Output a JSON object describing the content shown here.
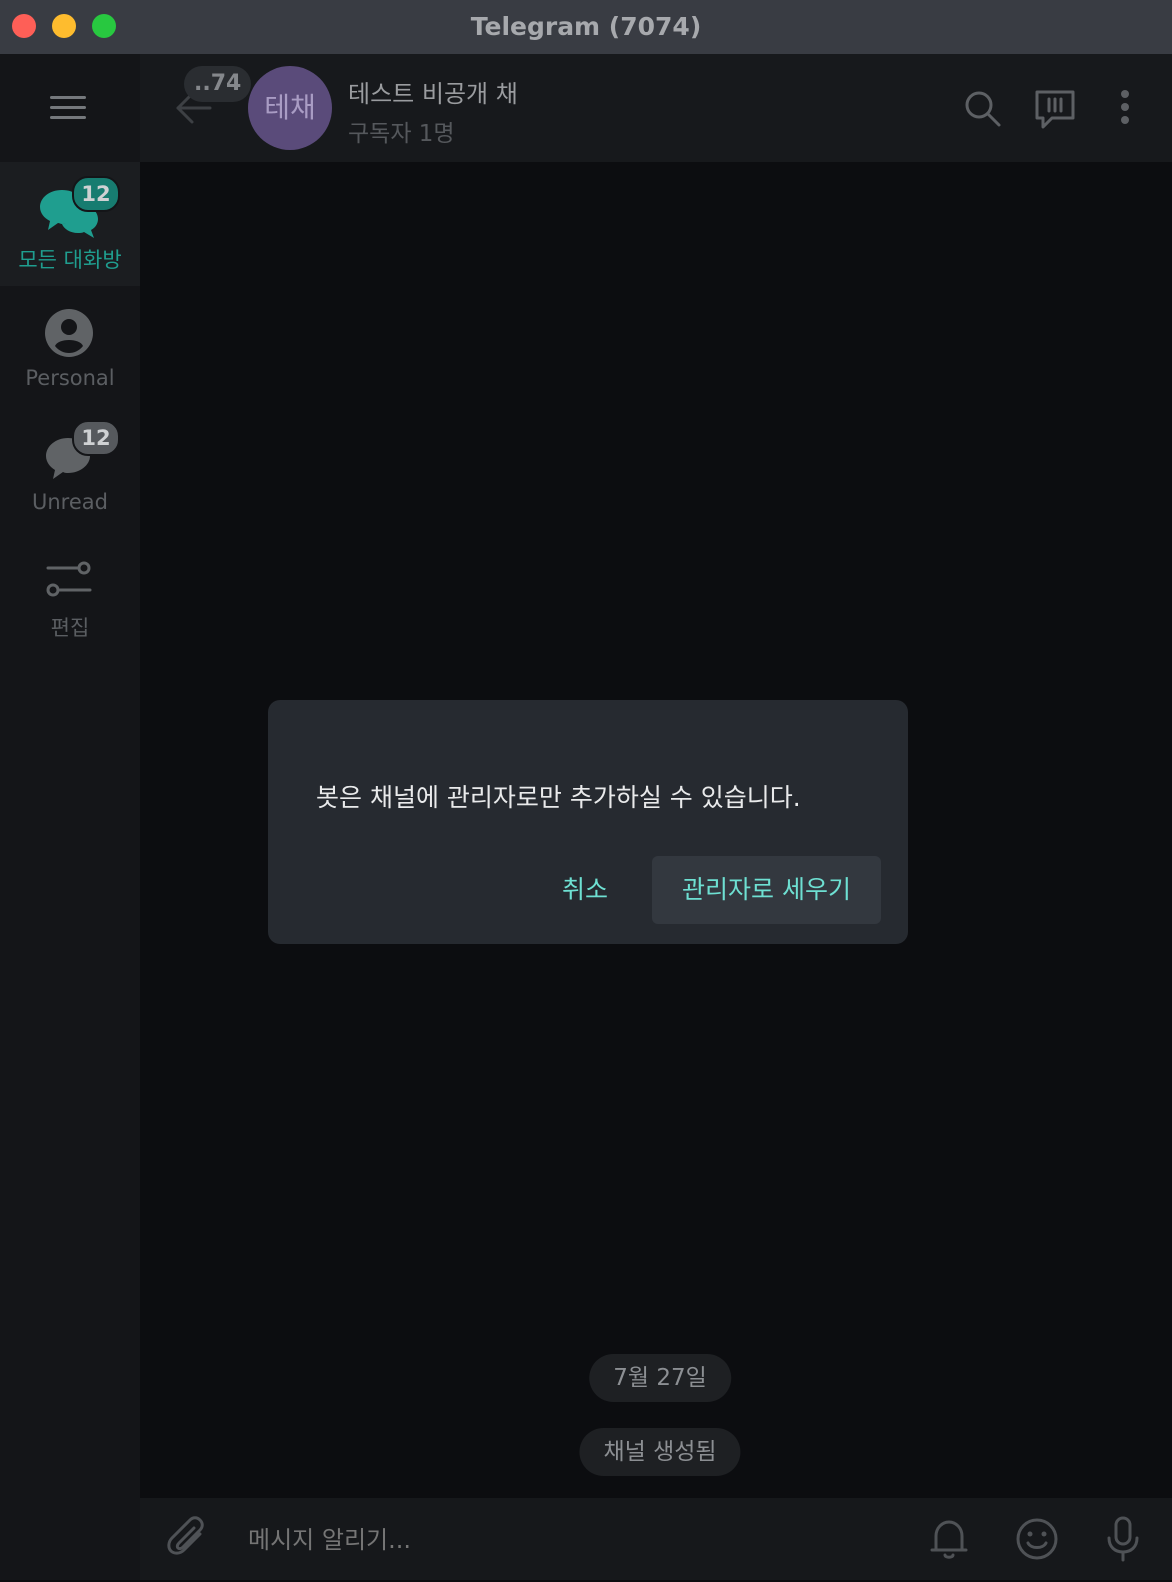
{
  "window": {
    "title": "Telegram (7074)",
    "traffic_lights": [
      "#fe5f57",
      "#febc2e",
      "#28c840"
    ]
  },
  "sidebar": {
    "menu_icon": "hamburger-icon",
    "folders": [
      {
        "label": "모든 대화방",
        "icon": "chats-icon",
        "badge": "12",
        "active": true
      },
      {
        "label": "Personal",
        "icon": "person-icon",
        "badge": "",
        "active": false
      },
      {
        "label": "Unread",
        "icon": "chat-bubble-icon",
        "badge": "12",
        "active": false
      },
      {
        "label": "편집",
        "icon": "sliders-icon",
        "badge": "",
        "active": false
      }
    ]
  },
  "header": {
    "back_badge": "..74",
    "avatar_initials": "테채",
    "chat_name": "테스트 비공개 채",
    "chat_status": "구독자 1명",
    "avatar_color": "#5a4b7a"
  },
  "chat": {
    "date_pill": "7월 27일",
    "service_message": "채널 생성됨"
  },
  "input": {
    "placeholder": "메시지 알리기..."
  },
  "dialog": {
    "message": "봇은 채널에 관리자로만 추가하실 수 있습니다.",
    "cancel_label": "취소",
    "confirm_label": "관리자로 세우기",
    "accent": "#6ee0d2"
  }
}
